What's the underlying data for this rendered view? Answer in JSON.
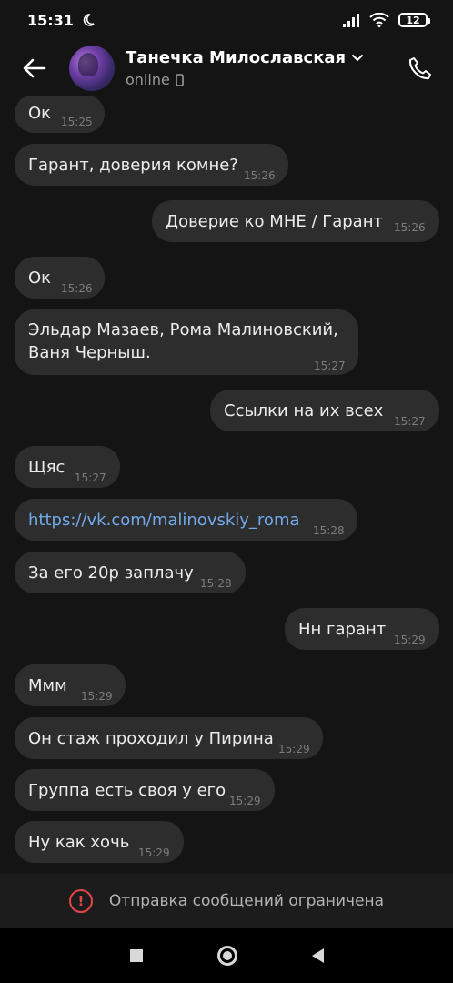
{
  "status_bar": {
    "time": "15:31",
    "battery": "12"
  },
  "header": {
    "name": "Танечка Милославская",
    "status": "online"
  },
  "messages": [
    {
      "text": "Ок",
      "time": "15:25",
      "out": false
    },
    {
      "text": "Гарант, доверия комне?",
      "time": "15:26",
      "out": false
    },
    {
      "text": "Доверие ко МНЕ / Гарант",
      "time": "15:26",
      "out": true
    },
    {
      "text": "Ок",
      "time": "15:26",
      "out": false
    },
    {
      "text": "Эльдар Мазаев, Рома Малиновский, Ваня Черныш.",
      "time": "15:27",
      "out": false
    },
    {
      "text": "Ссылки на их всех",
      "time": "15:27",
      "out": true
    },
    {
      "text": "Щяс",
      "time": "15:27",
      "out": false
    },
    {
      "text": "https://vk.com/malinovskiy_roma",
      "time": "15:28",
      "out": false,
      "link": true
    },
    {
      "text": "За его 20р заплачу",
      "time": "15:28",
      "out": false
    },
    {
      "text": "Нн гарант",
      "time": "15:29",
      "out": true
    },
    {
      "text": "Ммм",
      "time": "15:29",
      "out": false
    },
    {
      "text": "Он стаж проходил у Пирина",
      "time": "15:29",
      "out": false
    },
    {
      "text": "Группа есть своя у его",
      "time": "15:29",
      "out": false
    },
    {
      "text": "Ну как хочь",
      "time": "15:29",
      "out": false
    }
  ],
  "footer": {
    "notice": "Отправка сообщений ограничена"
  },
  "colors": {
    "background": "#141414",
    "bubble": "#2d2d2d",
    "link": "#71aaeb",
    "warning": "#e64646"
  },
  "icons": {
    "back": "arrow-left-icon",
    "call": "phone-icon",
    "warning": "exclamation-circle-icon",
    "chevron": "chevron-down-icon",
    "mobile": "mobile-device-icon"
  }
}
